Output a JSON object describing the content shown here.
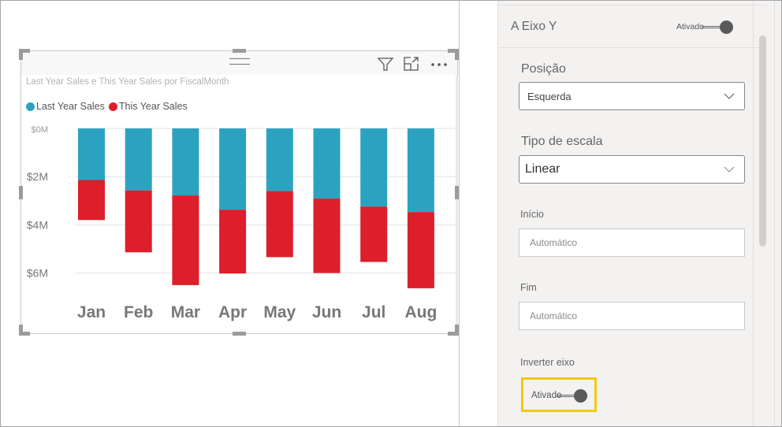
{
  "visual": {
    "title": "Last Year Sales e This Year Sales por FiscalMonth",
    "header_icons": [
      "drag-handle-icon",
      "filter-icon",
      "focus-mode-icon",
      "more-options-icon"
    ],
    "legend": [
      {
        "label": "Last Year Sales",
        "color": "#2ba3c0"
      },
      {
        "label": "This Year Sales",
        "color": "#dc1f2b"
      }
    ]
  },
  "chart_data": {
    "type": "bar",
    "stacked": true,
    "inverted_y_axis": true,
    "title": "Last Year Sales e This Year Sales por FiscalMonth",
    "xlabel": "",
    "ylabel": "",
    "categories": [
      "Jan",
      "Feb",
      "Mar",
      "Apr",
      "May",
      "Jun",
      "Jul",
      "Aug"
    ],
    "series": [
      {
        "name": "Last Year Sales",
        "color": "#2ba3c0",
        "values": [
          2.14,
          2.57,
          2.78,
          3.37,
          2.6,
          2.91,
          3.24,
          3.47
        ]
      },
      {
        "name": "This Year Sales",
        "color": "#dc1f2b",
        "values": [
          1.66,
          2.57,
          3.72,
          2.65,
          2.74,
          3.09,
          2.3,
          3.16
        ]
      }
    ],
    "units": "$M",
    "ylim": [
      0,
      7
    ],
    "yticks": [
      0,
      2,
      4,
      6
    ],
    "ytick_labels": [
      "$0M",
      "$2M",
      "$4M",
      "$6M"
    ],
    "grid": true,
    "legend_position": "top-left"
  },
  "pane": {
    "section_title": "A Eixo Y",
    "section_toggle": {
      "label": "Ativado",
      "on": true
    },
    "position": {
      "label": "Posição",
      "value": "Esquerda"
    },
    "scale_type": {
      "label": "Tipo de escala",
      "value": "Linear"
    },
    "start": {
      "label": "Início",
      "placeholder": "Automático",
      "value": ""
    },
    "end": {
      "label": "Fim",
      "placeholder": "Automático",
      "value": ""
    },
    "invert_axis": {
      "label": "Inverter eixo",
      "toggle_label": "Ativado",
      "on": true
    },
    "highlight_color": "#f2c811"
  }
}
